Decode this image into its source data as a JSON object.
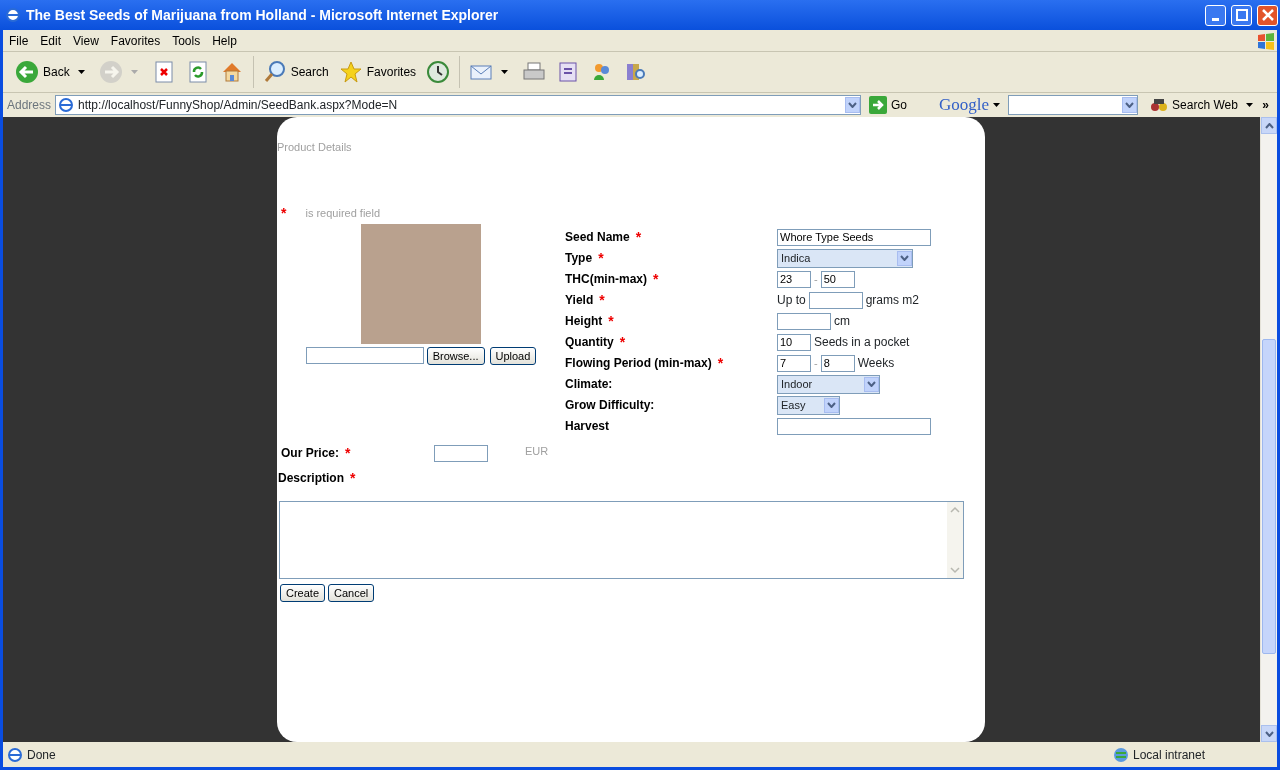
{
  "window": {
    "title": "The Best Seeds of Marijuana from Holland - Microsoft Internet Explorer"
  },
  "menu": [
    "File",
    "Edit",
    "View",
    "Favorites",
    "Tools",
    "Help"
  ],
  "toolbar": [
    {
      "label": "Back",
      "dropdown": true,
      "disabled": false
    },
    {
      "dropdown": true,
      "disabled": true
    },
    {
      "dropdown": false,
      "disabled": false
    },
    {
      "dropdown": false,
      "disabled": false
    },
    {
      "dropdown": false,
      "disabled": false
    },
    {
      "label": "Search",
      "dropdown": false,
      "disabled": false
    },
    {
      "label": "Favorites",
      "dropdown": false,
      "disabled": false
    },
    {
      "dropdown": false,
      "disabled": false
    },
    {
      "dropdown": true,
      "disabled": false
    },
    {
      "dropdown": false,
      "disabled": false
    },
    {
      "dropdown": false,
      "disabled": false
    },
    {
      "dropdown": false,
      "disabled": false
    },
    {
      "dropdown": false,
      "disabled": false
    }
  ],
  "address_bar": {
    "label": "Address",
    "url": "http://localhost/FunnyShop/Admin/SeedBank.aspx?Mode=N",
    "go": "Go",
    "search_engine": "Google",
    "search_button": "Search Web",
    "more": "»"
  },
  "page": {
    "heading": "Product Details",
    "required_note": {
      "mark": "*",
      "text": "is required field"
    },
    "upload": {
      "browse": "Browse...",
      "button": "Upload"
    },
    "fields": [
      {
        "label": "Seed Name",
        "required_mark": "*",
        "kind": "text",
        "value": "Whore Type Seeds",
        "wide": true
      },
      {
        "label": "Type",
        "required_mark": "*",
        "kind": "select",
        "value": "Indica",
        "wide": true
      },
      {
        "label": "THC(min-max)",
        "required_mark": "*",
        "kind": "range",
        "values": [
          "23",
          "50"
        ],
        "separator": "-",
        "wide": false
      },
      {
        "label": "Yield",
        "required_mark": "*",
        "kind": "text",
        "prefix": "Up to",
        "suffix": "grams m2",
        "wide": false
      },
      {
        "label": "Height",
        "required_mark": "*",
        "kind": "text",
        "suffix": "cm",
        "wide": false
      },
      {
        "label": "Quantity",
        "required_mark": "*",
        "kind": "text",
        "value": "10",
        "suffix": "Seeds in a pocket",
        "wide": false
      },
      {
        "label": "Flowing Period (min-max)",
        "required_mark": "*",
        "kind": "range",
        "values": [
          "7",
          "8"
        ],
        "separator": "-",
        "suffix": "Weeks",
        "wide": false
      },
      {
        "label": "Climate:",
        "kind": "select",
        "value": "Indoor",
        "wide": false
      },
      {
        "label": "Grow Difficulty:",
        "kind": "select",
        "value": "Easy",
        "wide": false
      },
      {
        "label": "Harvest",
        "kind": "text",
        "wide": true
      }
    ],
    "price": {
      "label": "Our Price:",
      "required_mark": "*",
      "currency": "EUR"
    },
    "description": {
      "label": "Description",
      "required_mark": "*"
    },
    "buttons": [
      "Create",
      "Cancel"
    ]
  },
  "status_bar": {
    "text": "Done",
    "zone": "Local intranet"
  }
}
